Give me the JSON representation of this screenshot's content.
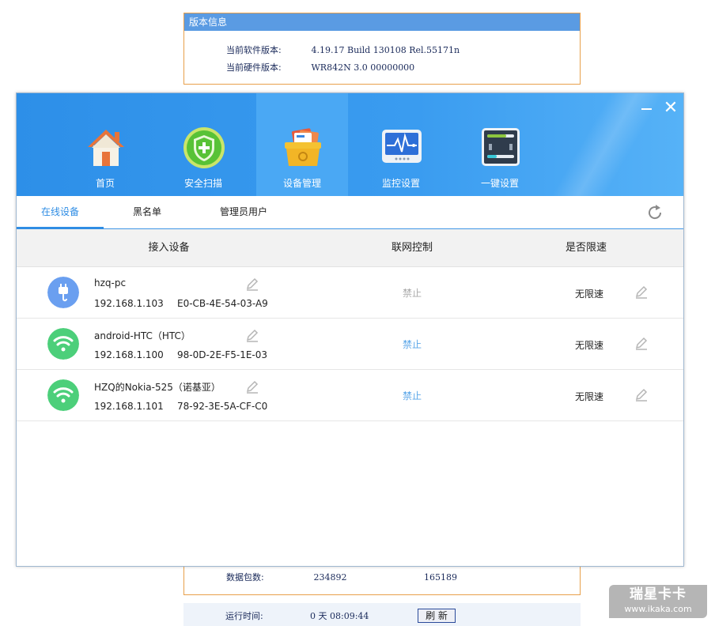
{
  "version_info": {
    "title": "版本信息",
    "software_label": "当前软件版本:",
    "software_value": "4.19.17 Build 130108 Rel.55171n",
    "hardware_label": "当前硬件版本:",
    "hardware_value": "WR842N 3.0 00000000"
  },
  "packets": {
    "label": "数据包数:",
    "sent": "234892",
    "received": "165189"
  },
  "uptime": {
    "label": "运行时间:",
    "value": "0 天 08:09:44",
    "refresh_label": "刷 新"
  },
  "window": {
    "minimize_icon": "minimize-icon",
    "close_label": "✕"
  },
  "nav": {
    "items": [
      {
        "label": "首页",
        "icon": "home-icon"
      },
      {
        "label": "安全扫描",
        "icon": "shield-icon"
      },
      {
        "label": "设备管理",
        "icon": "device-box-icon",
        "active": true
      },
      {
        "label": "监控设置",
        "icon": "monitor-icon"
      },
      {
        "label": "一键设置",
        "icon": "settings-panel-icon"
      }
    ]
  },
  "subtabs": {
    "items": [
      "在线设备",
      "黑名单",
      "管理员用户"
    ],
    "active_index": 0
  },
  "table": {
    "headers": [
      "接入设备",
      "联网控制",
      "是否限速"
    ],
    "rows": [
      {
        "name": "hzq-pc",
        "ip": "192.168.1.103",
        "mac": "E0-CB-4E-54-03-A9",
        "control": "禁止",
        "speed": "无限速",
        "device_icon": "cable-plug-icon",
        "icon_color": "#6a9ff0",
        "control_color": "#aaaaaa"
      },
      {
        "name": "android-HTC（HTC）",
        "ip": "192.168.1.100",
        "mac": "98-0D-2E-F5-1E-03",
        "control": "禁止",
        "speed": "无限速",
        "device_icon": "wifi-icon",
        "icon_color": "#4ccf7a",
        "control_color": "#5aa6e8"
      },
      {
        "name": "HZQ的Nokia-525（诺基亚）",
        "ip": "192.168.1.101",
        "mac": "78-92-3E-5A-CF-C0",
        "control": "禁止",
        "speed": "无限速",
        "device_icon": "wifi-icon",
        "icon_color": "#4ccf7a",
        "control_color": "#5aa6e8"
      }
    ]
  },
  "watermark": {
    "line1": "瑞星卡卡",
    "line2": "www.ikaka.com"
  },
  "colors": {
    "header_blue": "#3a9cf0",
    "accent": "#2f8de4",
    "border_orange": "#e8a04b"
  }
}
